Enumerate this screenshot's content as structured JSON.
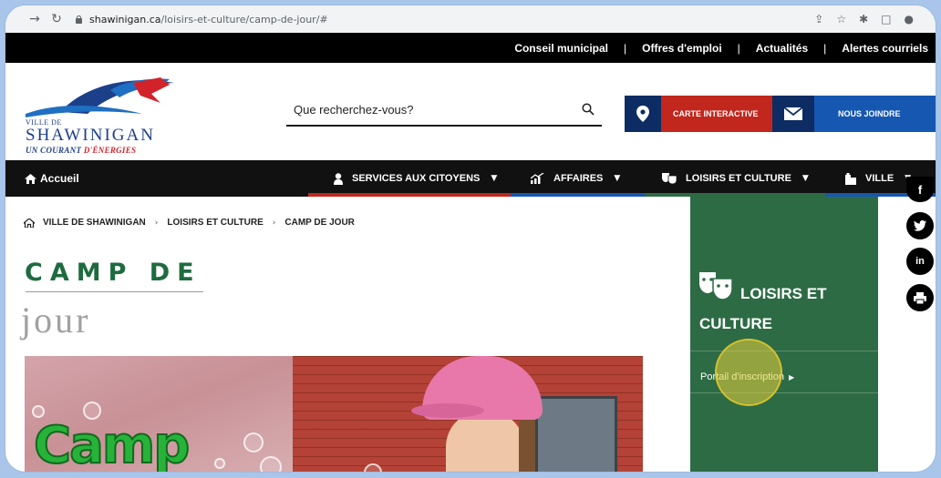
{
  "browser": {
    "url_domain": "shawinigan.ca",
    "url_path": "/loisirs-et-culture/camp-de-jour/#"
  },
  "top_links": [
    "Conseil municipal",
    "Offres d'emploi",
    "Actualités",
    "Alertes courriels"
  ],
  "logo": {
    "ville_de": "VILLE DE",
    "name": "SHAWINIGAN",
    "tagline_part1": "UN COURANT ",
    "tagline_part2": "D'ÉNERGIES"
  },
  "search": {
    "placeholder": "Que recherchez-vous?"
  },
  "header_buttons": {
    "carte": "CARTE INTERACTIVE",
    "joindre": "NOUS JOINDRE"
  },
  "nav": {
    "home": "Accueil",
    "services": "SERVICES AUX CITOYENS",
    "affaires": "AFFAIRES",
    "loisirs": "LOISIRS ET CULTURE",
    "ville": "VILLE"
  },
  "breadcrumb": [
    "VILLE DE SHAWINIGAN",
    "LOISIRS ET CULTURE",
    "CAMP DE JOUR"
  ],
  "page_title": {
    "line1": "CAMP DE",
    "line2": "jour"
  },
  "hero": {
    "text": "Camp"
  },
  "sidebar": {
    "title_line1": "LOISIRS ET",
    "title_line2": "CULTURE",
    "link": "Portail d'inscription"
  },
  "social": {
    "facebook": "f",
    "twitter": "t",
    "linkedin": "in",
    "print": "print"
  },
  "colors": {
    "brand_green": "#1e6b3f",
    "sidebar_green": "#2d6b45",
    "red": "#c1271d",
    "navy": "#0d2c63",
    "blue": "#1657b2"
  }
}
